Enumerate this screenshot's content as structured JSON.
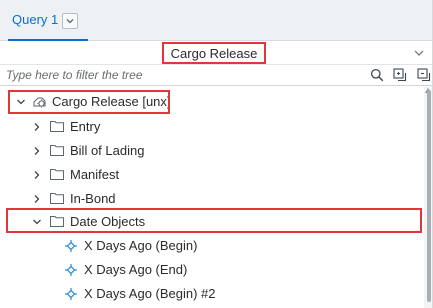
{
  "tabs": [
    {
      "label": "Query 1",
      "active": true,
      "dropdown_icon": "chevron-down-icon"
    }
  ],
  "universe": {
    "selected": "Cargo Release",
    "dropdown_icon": "chevron-down-icon"
  },
  "filter": {
    "value": "",
    "placeholder": "Type here to filter the tree",
    "tools": [
      "search-icon",
      "expand-all-icon",
      "collapse-all-icon"
    ]
  },
  "tree": {
    "root": {
      "label": "Cargo Release [unx]",
      "icon": "universe-icon",
      "expanded": true
    },
    "folders": [
      {
        "label": "Entry",
        "expanded": false
      },
      {
        "label": "Bill of Lading",
        "expanded": false
      },
      {
        "label": "Manifest",
        "expanded": false
      },
      {
        "label": "In-Bond",
        "expanded": false
      },
      {
        "label": "Date Objects",
        "expanded": true
      }
    ],
    "objects": [
      {
        "label": "X Days Ago (Begin)",
        "icon": "dimension-object-icon"
      },
      {
        "label": "X Days Ago (End)",
        "icon": "dimension-object-icon"
      },
      {
        "label": "X Days Ago (Begin) #2",
        "icon": "dimension-object-icon"
      }
    ]
  },
  "colors": {
    "accent": "#0a6ed1",
    "highlight": "#e0373b",
    "tab_bg": "#eef1f4",
    "text": "#2b2b2b",
    "object_icon": "#2a8dd4"
  }
}
